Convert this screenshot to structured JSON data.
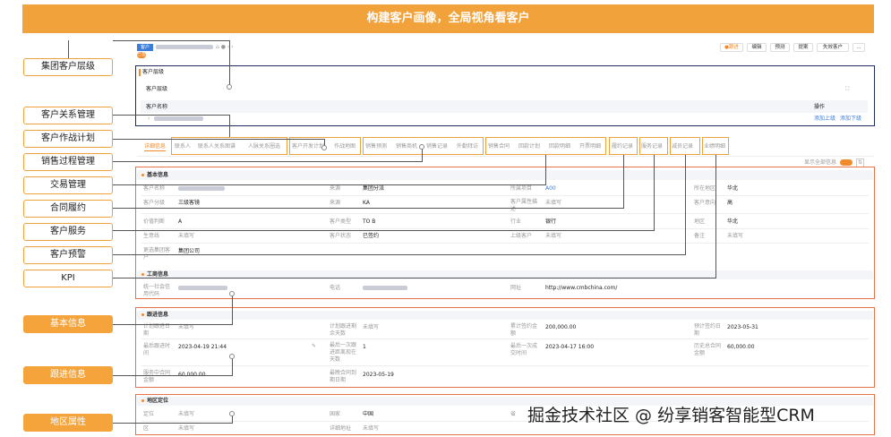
{
  "banner": "构建客户画像，全局视角看客户",
  "labels": {
    "group_hierarchy": "集团客户层级",
    "relationship": "客户关系管理",
    "battle_plan": "客户作战计划",
    "sales_process": "销售过程管理",
    "transaction": "交易管理",
    "contract": "合同履约",
    "service": "客户服务",
    "alert": "客户预警",
    "kpi": "KPI",
    "basic_info": "基本信息",
    "followup_info": "跟进信息",
    "region_attr": "地区属性"
  },
  "header": {
    "tag": "客户",
    "tag2": "已签",
    "follow_btn": "●跟进",
    "actions": [
      "编辑",
      "预测",
      "提案",
      "失效客户",
      "..."
    ]
  },
  "hierarchy": {
    "section": "客户层级",
    "sub": "客户层级",
    "col_name": "客户名称",
    "col_ops": "操作",
    "op_add_up": "添加上级",
    "op_add_down": "添加下级"
  },
  "tabs": [
    "详细信息",
    "联系人",
    "联系人关系图谱",
    "人脉关系圈选",
    "客户开发计划",
    "作战地图",
    "销售预测",
    "销售商机",
    "销售记录",
    "外勤拜访",
    "销售合同",
    "回款计划",
    "回款明细",
    "开票明细",
    "履约记录",
    "服务记录",
    "减员记录",
    "业绩明细"
  ],
  "show_all": "显示全部信息",
  "basic": {
    "title": "基本信息",
    "rows": [
      [
        [
          "客户名称",
          ""
        ],
        [
          "来源",
          "集团分派"
        ],
        [
          "所属项目",
          "A00"
        ],
        [
          "所在地区",
          "华北"
        ]
      ],
      [
        [
          "客户分级",
          "三级客镜"
        ],
        [
          "来源",
          "KA"
        ],
        [
          "客户属性描述",
          "未填写"
        ],
        [
          "客户意向",
          "高"
        ]
      ],
      [
        [
          "价值判断",
          "A"
        ],
        [
          "客户类型",
          "TO B"
        ],
        [
          "行业",
          "银行"
        ],
        [
          "地区",
          "华北"
        ]
      ],
      [
        [
          "生意线",
          "未填写"
        ],
        [
          "客户状态",
          "已签约"
        ],
        [
          "上级客户",
          "未填写"
        ],
        [
          "备注",
          "未填写"
        ]
      ],
      [
        [
          "更选集团客户",
          "集团公司"
        ],
        [
          "",
          ""
        ],
        [
          "",
          ""
        ],
        [
          "",
          ""
        ]
      ]
    ],
    "biz_title": "工商信息",
    "biz_rows": [
      [
        "统一社会信用代码",
        ""
      ],
      [
        "电话",
        ""
      ],
      [
        "网址",
        "http://www.cmbchina.com/"
      ]
    ]
  },
  "followup": {
    "title": "跟进信息",
    "rows": [
      [
        [
          "计划跟进日期",
          "未填写"
        ],
        [
          "计划跟进剩余天数",
          "未填写"
        ],
        [
          "累计签约金额",
          "200,000.00"
        ],
        [
          "预计签约日期",
          "2023-05-31"
        ]
      ],
      [
        [
          "最后跟进时间",
          "2023-04-19 21:44"
        ],
        [
          "最后一次跟进距离现在天数",
          "1"
        ],
        [
          "最后一次成交时间",
          "2023-04-17 16:00"
        ],
        [
          "历史总合同金额",
          "60,000.00"
        ]
      ],
      [
        [
          "服务中合同金额",
          "60,000.00"
        ],
        [
          "最晚合同到期日期",
          "2023-05-19"
        ],
        [
          "",
          ""
        ],
        [
          "",
          ""
        ]
      ]
    ]
  },
  "region": {
    "title": "地区定位",
    "rows": [
      [
        [
          "定位",
          "未填写"
        ],
        [
          "国家",
          "中国"
        ],
        [
          "省",
          ""
        ]
      ],
      [
        [
          "区",
          "未填写"
        ],
        [
          "详细地址",
          "未填写"
        ],
        [
          "",
          ""
        ]
      ]
    ]
  },
  "watermark": "掘金技术社区 @ 纷享销客智能型CRM"
}
